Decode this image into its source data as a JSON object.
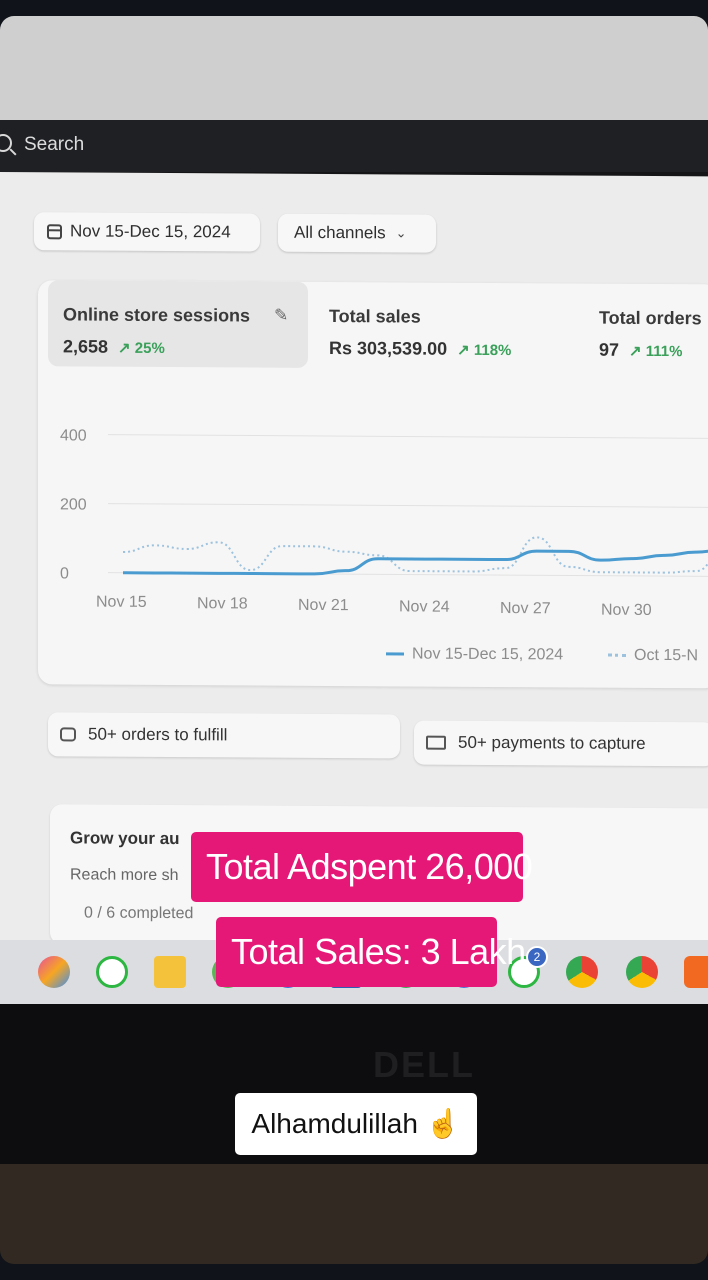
{
  "search": {
    "label": "Search"
  },
  "filters": {
    "date_range": "Nov 15-Dec 15, 2024",
    "channels": "All channels"
  },
  "metrics": [
    {
      "label": "Online store sessions",
      "value": "2,658",
      "change": "↗ 25%"
    },
    {
      "label": "Total sales",
      "value": "Rs 303,539.00",
      "change": "↗ 118%"
    },
    {
      "label": "Total orders",
      "value": "97",
      "change": "↗ 111%"
    }
  ],
  "chart_data": {
    "type": "line",
    "title": "",
    "xlabel": "",
    "ylabel": "",
    "ylim": [
      0,
      400
    ],
    "y_ticks": [
      "400",
      "200",
      "0"
    ],
    "x_ticks": [
      "Nov 15",
      "Nov 18",
      "Nov 21",
      "Nov 24",
      "Nov 27",
      "Nov 30"
    ],
    "grid": true,
    "legend_position": "bottom-right",
    "series": [
      {
        "name": "Nov 15-Dec 15, 2024",
        "style": "solid",
        "color": "#4a9bd0",
        "x": [
          0,
          1,
          2,
          3,
          4,
          5,
          6,
          7,
          8,
          9,
          10,
          11,
          12,
          13,
          14,
          15,
          16,
          17,
          18,
          19
        ],
        "y": [
          0,
          0,
          0,
          0,
          0,
          0,
          0,
          10,
          45,
          45,
          45,
          45,
          45,
          70,
          70,
          45,
          50,
          60,
          70,
          80
        ]
      },
      {
        "name": "Oct 15-N",
        "style": "dotted",
        "color": "#9cc2de",
        "x": [
          0,
          1,
          2,
          3,
          4,
          5,
          6,
          7,
          8,
          9,
          10,
          11,
          12,
          13,
          14,
          15,
          16,
          17,
          18,
          19
        ],
        "y": [
          60,
          80,
          70,
          90,
          10,
          80,
          80,
          65,
          55,
          10,
          10,
          10,
          20,
          110,
          25,
          10,
          10,
          10,
          15,
          100
        ]
      }
    ]
  },
  "tasks": {
    "fulfill": "50+ orders to fulfill",
    "capture": "50+ payments to capture"
  },
  "grow": {
    "title": "Grow your au",
    "subtitle": "Reach more sh",
    "progress": "0 / 6 completed"
  },
  "taskbar": {
    "whatsapp_badge": "2"
  },
  "brand": {
    "laptop_logo": "DELL"
  },
  "overlays": {
    "adspent": "Total Adspent 26,000",
    "sales": "Total Sales: 3 Lakh",
    "caption": "Alhamdulillah ☝️"
  },
  "colors": {
    "overlay": "#e51877",
    "line_current": "#4a9bd0",
    "line_previous": "#9cc2de",
    "positive": "#3aa05a"
  }
}
